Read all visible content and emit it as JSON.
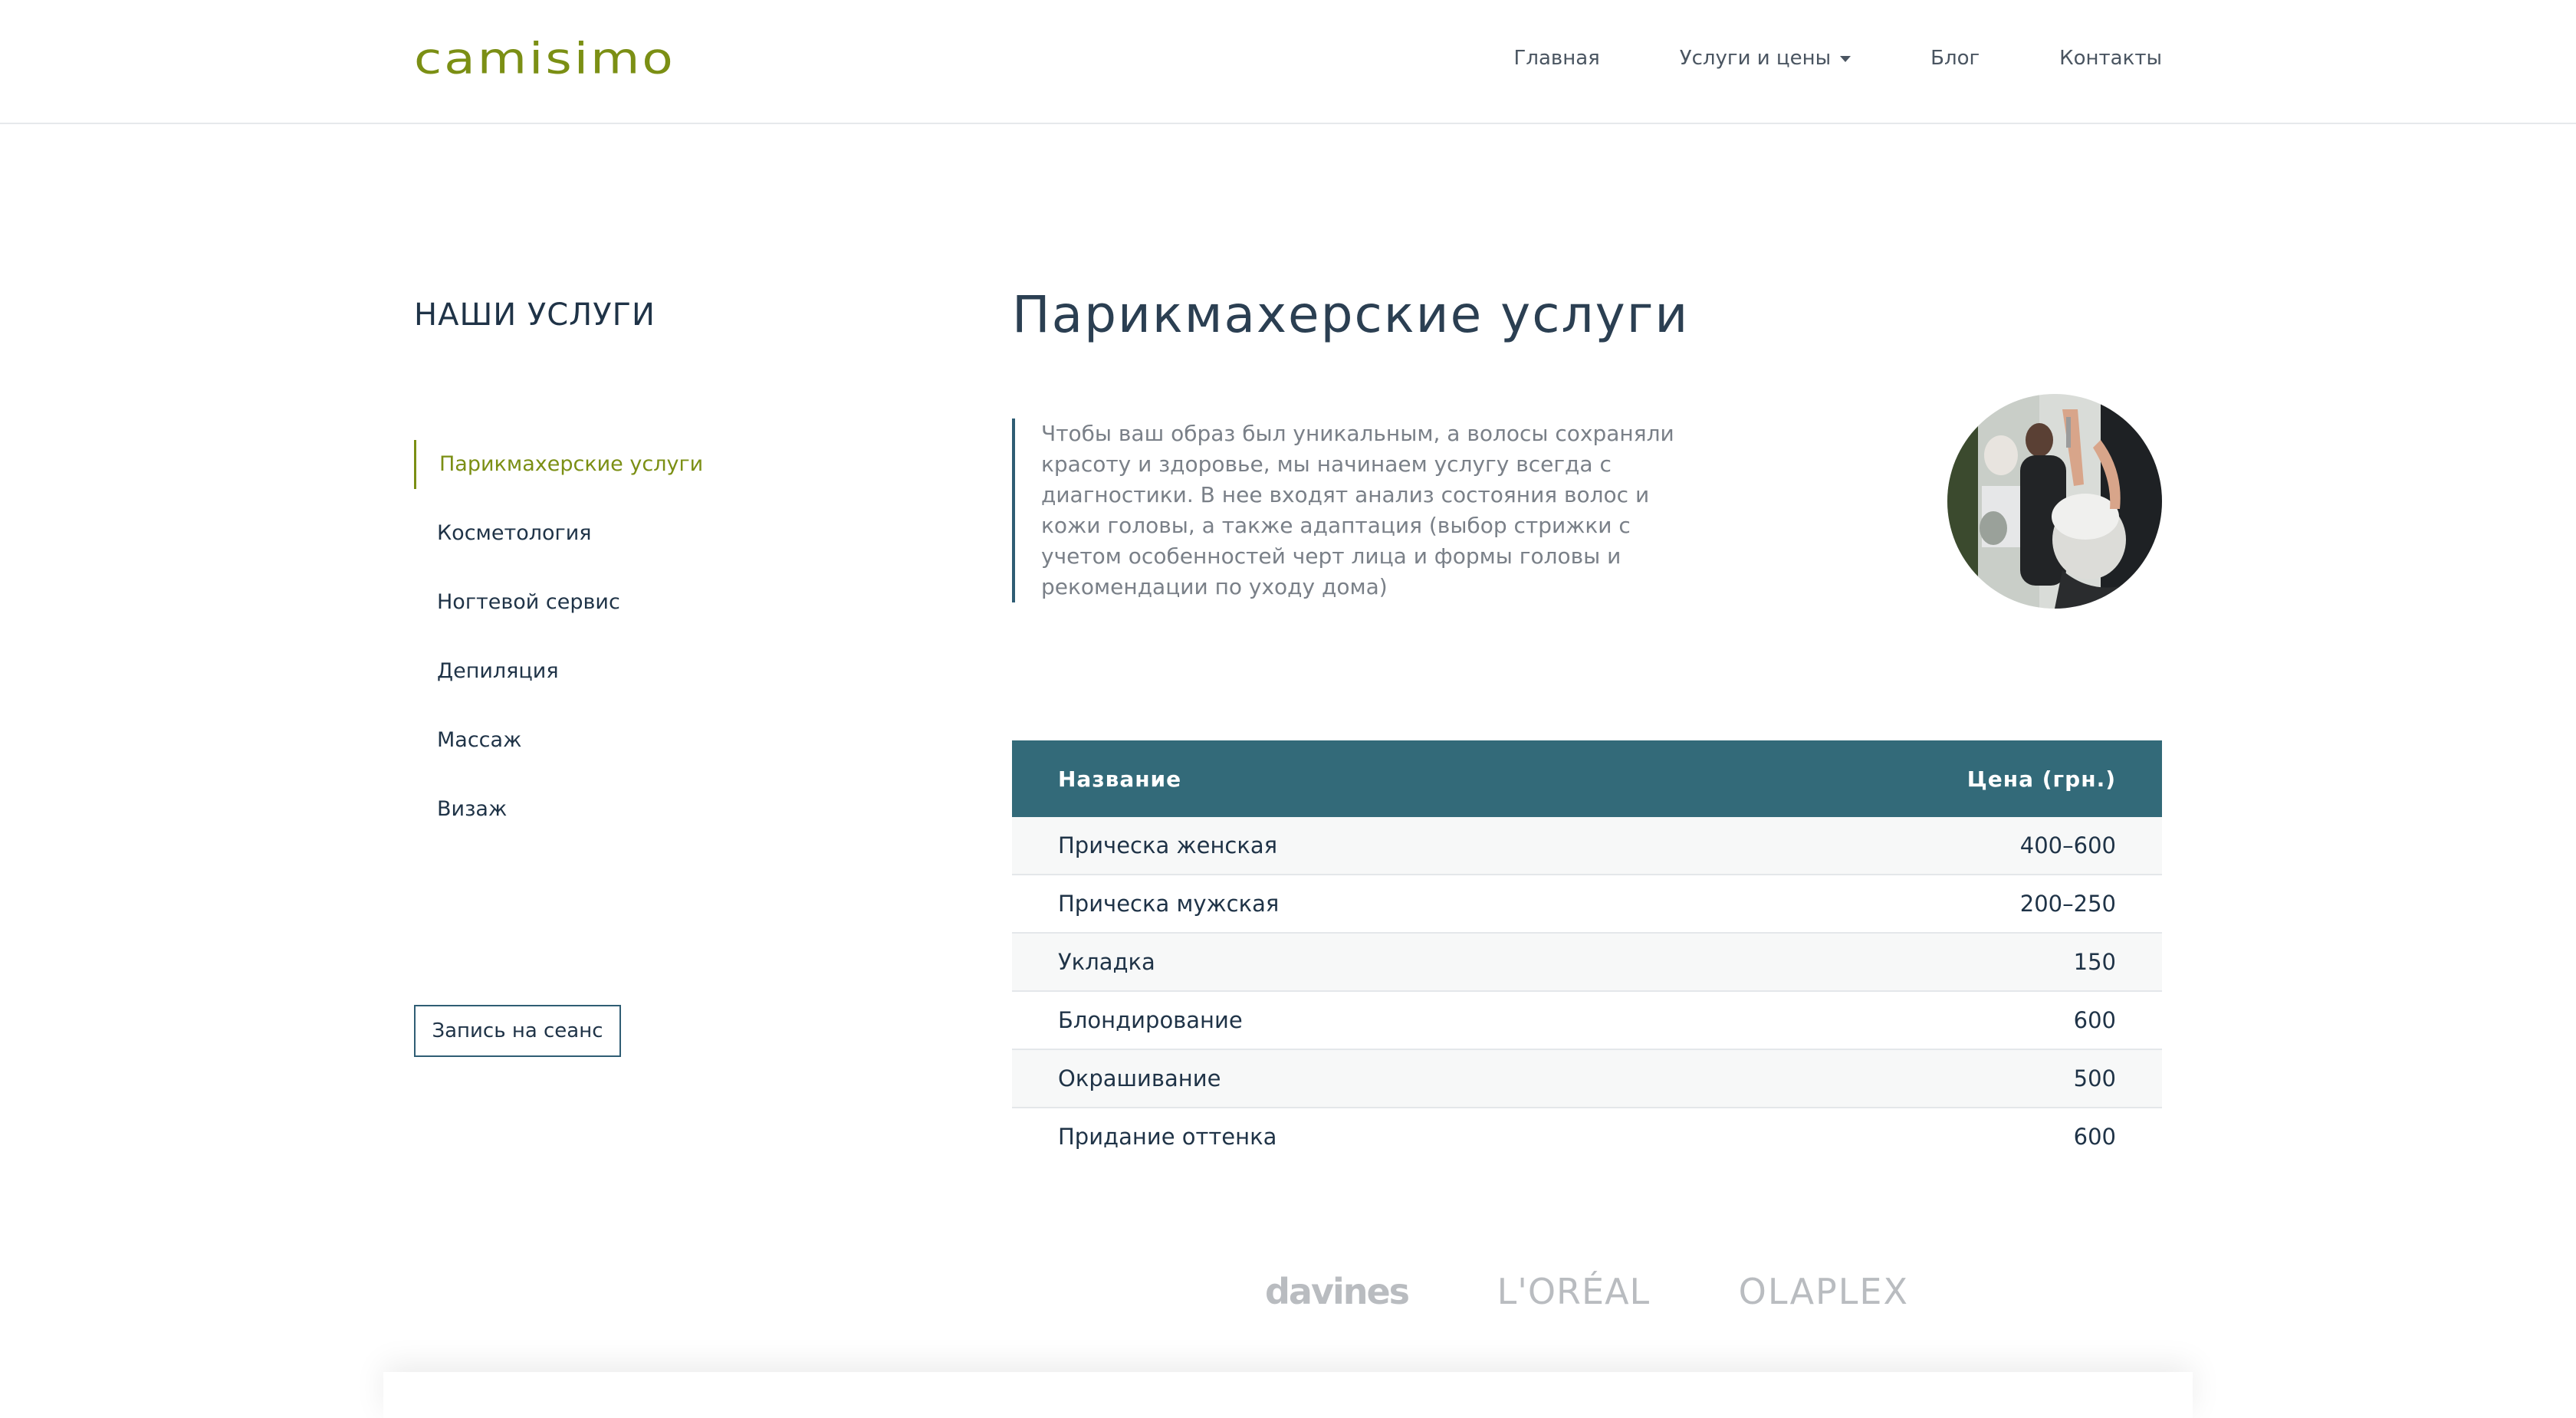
{
  "brand": {
    "name": "camisimo",
    "color": "#7b8f14"
  },
  "nav": {
    "items": [
      {
        "label": "Главная"
      },
      {
        "label": "Услуги и цены",
        "dropdown": true
      },
      {
        "label": "Блог"
      },
      {
        "label": "Контакты"
      }
    ]
  },
  "sidebar": {
    "title": "НАШИ УСЛУГИ",
    "items": [
      {
        "label": "Парикмахерские услуги",
        "active": true
      },
      {
        "label": "Косметология"
      },
      {
        "label": "Ногтевой сервис"
      },
      {
        "label": "Депиляция"
      },
      {
        "label": "Массаж"
      },
      {
        "label": "Визаж"
      }
    ],
    "book_button": "Запись на сеанс"
  },
  "main": {
    "title": "Парикмахерские услуги",
    "intro": "Чтобы ваш образ был уникальным, а волосы сохраняли красоту и здоровье, мы начинаем услугу всегда с диагностики. В нее входят анализ состояния волос и кожи головы, а также адаптация (выбор стрижки с учетом особенностей черт лица и формы головы и рекомендации по уходу дома)"
  },
  "price_table": {
    "headers": {
      "name": "Название",
      "price": "Цена (грн.)"
    },
    "rows": [
      {
        "name": "Прическа женская",
        "price": "400–600"
      },
      {
        "name": "Прическа мужская",
        "price": "200–250"
      },
      {
        "name": "Укладка",
        "price": "150"
      },
      {
        "name": "Блондирование",
        "price": "600"
      },
      {
        "name": "Окрашивание",
        "price": "500"
      },
      {
        "name": "Придание оттенка",
        "price": "600"
      }
    ],
    "header_color": "#336a79"
  },
  "brands": [
    "davines",
    "L'ORÉAL",
    "OLAPLEX"
  ]
}
